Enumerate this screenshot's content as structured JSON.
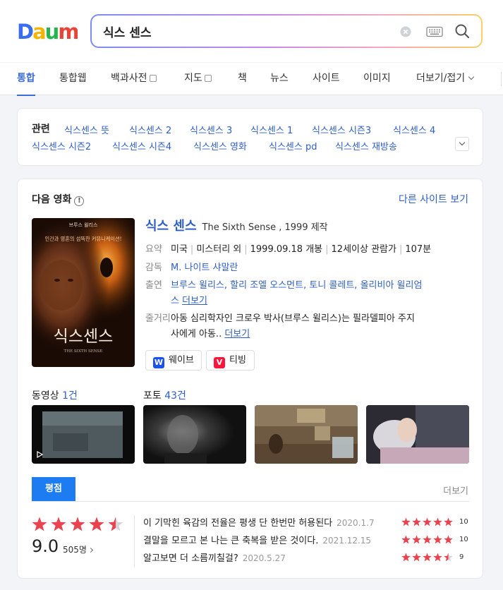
{
  "header": {
    "logo_text": "Daum",
    "search": {
      "value": "식스 센스"
    }
  },
  "tabs": [
    {
      "label": "통합",
      "active": true
    },
    {
      "label": "통합웹"
    },
    {
      "label": "백과사전",
      "external": true
    },
    {
      "label": "지도",
      "external": true
    },
    {
      "label": "책"
    },
    {
      "label": "뉴스"
    },
    {
      "label": "사이트"
    },
    {
      "label": "이미지"
    },
    {
      "label": "더보기/접기",
      "dropdown": true
    }
  ],
  "related": {
    "title": "관련",
    "links": [
      "식스센스 뜻",
      "식스센스 2",
      "식스센스 3",
      "식스센스 1",
      "식스센스 시즌3",
      "식스센스 4",
      "식스센스 시즌2",
      "식스센스 시즌4",
      "식스센스 영화",
      "식스센스 pd",
      "식스센스 재방송"
    ]
  },
  "movie": {
    "section_title": "다음 영화",
    "info_glyph": "!",
    "other_site": "다른 사이트 보기",
    "poster": {
      "top_text": "브루스 윌리스",
      "tagline": "인간과 영혼의 섬뜩한 커뮤니케이션!",
      "title_ko": "식스센스",
      "title_en": "THE SIXTH SENSE"
    },
    "title_ko": "식스 센스",
    "title_en": "The Sixth Sense , 1999 제작",
    "summary": {
      "label": "요약",
      "parts": [
        "미국",
        "미스터리 외",
        "1999.09.18 개봉",
        "12세이상 관람가",
        "107분"
      ]
    },
    "director": {
      "label": "감독",
      "name": "M. 나이트 샤말란"
    },
    "cast": {
      "label": "출연",
      "line1": "브루스 윌리스, 할리 조엘 오스먼트, 토니 콜레트, 올리비아 윌리엄",
      "line2": "스",
      "more": "더보기"
    },
    "plot": {
      "label": "줄거리",
      "line1": "아동 심리학자인 크로우 박사(브루스 윌리스)는 필라델피아 주지",
      "line2": "사에게 아동..",
      "more": "더보기"
    },
    "ott": [
      {
        "label": "웨이브",
        "badge": "W",
        "color": "#1a51f0"
      },
      {
        "label": "티빙",
        "badge": "V",
        "color": "#ff153c"
      }
    ],
    "video": {
      "label": "동영상",
      "count": "1건"
    },
    "photo": {
      "label": "포토",
      "count": "43건"
    }
  },
  "rating": {
    "tab_label": "평점",
    "more": "더보기",
    "score": "9.0",
    "score_fraction": 0.9,
    "reviewers": "505명",
    "reviews": [
      {
        "text": "이 기막힌 육감의 전율은 평생 단 한번만 허용된다",
        "date": "2020.1.7",
        "score": "10",
        "fraction": 1.0
      },
      {
        "text": "결말을 모르고 본 나는 큰 축복을 받은 것이다.",
        "date": "2021.12.15",
        "score": "10",
        "fraction": 1.0
      },
      {
        "text": "알고보면 더 소름끼칠걸?",
        "date": "2020.5.27",
        "score": "9",
        "fraction": 0.9
      }
    ],
    "star_color": "#e8434f",
    "star_empty_color": "#d5d5d5"
  }
}
